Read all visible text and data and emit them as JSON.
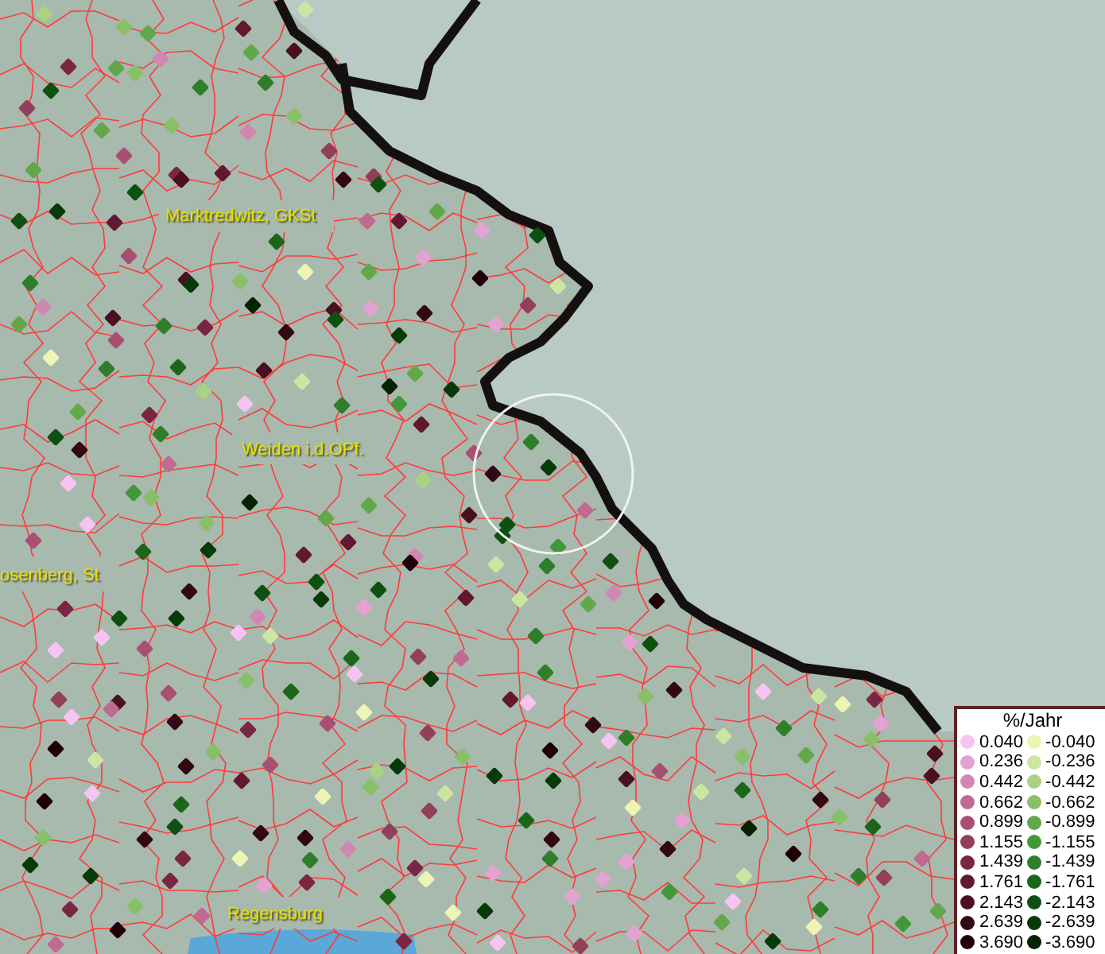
{
  "places": [
    {
      "name": "Marktredwitz, GKSt"
    },
    {
      "name": "Weiden i.d.OPf."
    },
    {
      "name": "osenberg, St"
    },
    {
      "name": "Regensburg"
    }
  ],
  "legend": {
    "title": "%/Jahr",
    "positive": [
      {
        "value": "0.040",
        "color": "#f6c4f0"
      },
      {
        "value": "0.236",
        "color": "#e4a2d2"
      },
      {
        "value": "0.442",
        "color": "#d286b2"
      },
      {
        "value": "0.662",
        "color": "#c06a92"
      },
      {
        "value": "0.899",
        "color": "#aa4e72"
      },
      {
        "value": "1.155",
        "color": "#92405a"
      },
      {
        "value": "1.439",
        "color": "#7a2642"
      },
      {
        "value": "1.761",
        "color": "#621830"
      },
      {
        "value": "2.143",
        "color": "#4a1020"
      },
      {
        "value": "2.639",
        "color": "#320812"
      },
      {
        "value": "3.690",
        "color": "#200008"
      }
    ],
    "negative": [
      {
        "value": "-0.040",
        "color": "#eef4b4"
      },
      {
        "value": "-0.236",
        "color": "#cce6a2"
      },
      {
        "value": "-0.442",
        "color": "#aad282"
      },
      {
        "value": "-0.662",
        "color": "#88c068"
      },
      {
        "value": "-0.899",
        "color": "#62a84a"
      },
      {
        "value": "-1.155",
        "color": "#429838"
      },
      {
        "value": "-1.439",
        "color": "#2e7e2a"
      },
      {
        "value": "-1.761",
        "color": "#1c6618"
      },
      {
        "value": "-2.143",
        "color": "#0e5010"
      },
      {
        "value": "-2.639",
        "color": "#063a08"
      },
      {
        "value": "-3.690",
        "color": "#042204"
      }
    ]
  }
}
